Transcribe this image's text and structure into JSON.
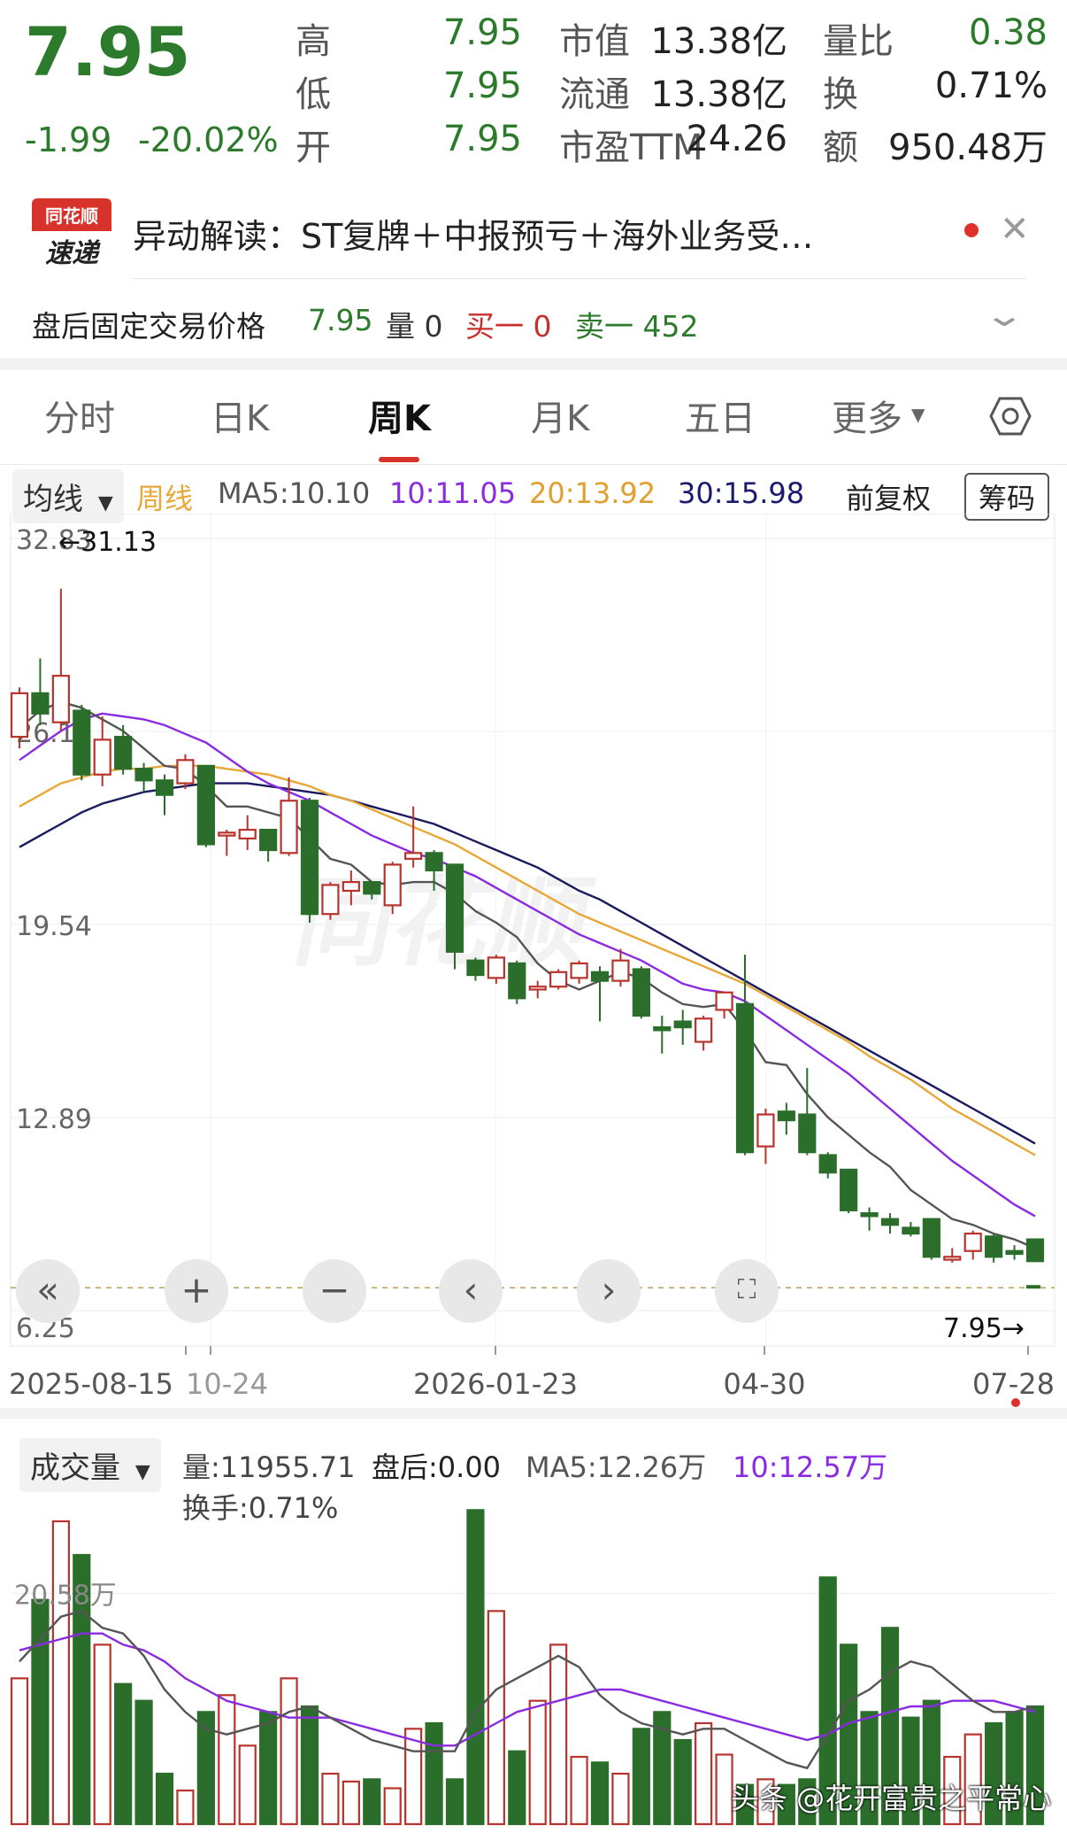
{
  "quote": {
    "price": "7.95",
    "change": "-1.99",
    "change_pct": "-20.02%",
    "rows": [
      {
        "l1": "高",
        "v1": "7.95",
        "l2": "市值",
        "v2": "13.38亿",
        "l3": "量比",
        "v3": "0.38"
      },
      {
        "l1": "低",
        "v1": "7.95",
        "l2": "流通",
        "v2": "13.38亿",
        "l3": "换",
        "v3": "0.71%"
      },
      {
        "l1": "开",
        "v1": "7.95",
        "l2": "市盈TTM",
        "v2": "24.26",
        "l3": "额",
        "v3": "950.48万"
      }
    ]
  },
  "news": {
    "badge_top": "同花顺",
    "badge_bottom": "速递",
    "text": "异动解读：ST复牌＋中报预亏＋海外业务受…"
  },
  "after_hours": {
    "label": "盘后固定交易价格",
    "price": "7.95",
    "volume": "量 0",
    "buy": "买一 0",
    "sell": "卖一 452"
  },
  "tabs": [
    "分时",
    "日K",
    "周K",
    "月K",
    "五日",
    "更多"
  ],
  "active_tab": "周K",
  "ma_bar": {
    "selector": "均线",
    "period": "周线",
    "ma5": "MA5:10.10",
    "ma10": "10:11.05",
    "ma20": "20:13.92",
    "ma30": "30:15.98",
    "adjust": "前复权",
    "chips": "筹码"
  },
  "volume_bar": {
    "selector": "成交量",
    "vol": "量:11955.71",
    "after": "盘后:0.00",
    "ma5": "MA5:12.26万",
    "ma10": "10:12.57万",
    "turnover": "换手:0.71%"
  },
  "watermark": "头条 @花开富贵之平常心",
  "colors": {
    "up": "#b8332c",
    "down": "#2b6e2b",
    "ma5": "#555555",
    "ma10": "#8a2be2",
    "ma20": "#e8a838",
    "ma30": "#1a1a5e"
  },
  "chart_data": {
    "type": "candlestick",
    "y_ticks": [
      "32.83",
      "26.19",
      "19.54",
      "12.89",
      "6.25"
    ],
    "x_labels": [
      "2025-08-15",
      "10-24",
      "2026-01-23",
      "04-30",
      "07-28"
    ],
    "max_label": "←31.13",
    "last_label": "7.95→",
    "ylim": [
      6.25,
      32.83
    ],
    "candles": [
      [
        26.0,
        27.5,
        25.6,
        27.7
      ],
      [
        27.5,
        26.8,
        26.4,
        28.7
      ],
      [
        26.5,
        28.1,
        26.2,
        31.1
      ],
      [
        26.9,
        24.7,
        24.5,
        27.1
      ],
      [
        24.7,
        25.9,
        24.3,
        26.7
      ],
      [
        26.0,
        24.9,
        24.7,
        26.4
      ],
      [
        24.9,
        24.5,
        24.1,
        25.1
      ],
      [
        24.5,
        24.0,
        23.3,
        24.7
      ],
      [
        24.4,
        25.2,
        24.2,
        25.4
      ],
      [
        25.0,
        22.3,
        22.2,
        25.0
      ],
      [
        22.6,
        22.7,
        21.9,
        22.8
      ],
      [
        22.5,
        22.8,
        22.1,
        23.3
      ],
      [
        22.8,
        22.1,
        21.7,
        22.8
      ],
      [
        22.0,
        23.8,
        21.9,
        24.6
      ],
      [
        23.8,
        19.9,
        19.6,
        23.9
      ],
      [
        19.9,
        20.9,
        19.7,
        21.0
      ],
      [
        20.7,
        21.0,
        20.2,
        21.4
      ],
      [
        21.0,
        20.6,
        20.4,
        21.0
      ],
      [
        20.2,
        21.6,
        19.9,
        21.7
      ],
      [
        21.8,
        22.0,
        21.5,
        23.6
      ],
      [
        22.0,
        21.4,
        20.7,
        22.1
      ],
      [
        21.6,
        18.6,
        18.0,
        21.6
      ],
      [
        18.3,
        17.8,
        17.6,
        18.4
      ],
      [
        17.7,
        18.4,
        17.5,
        18.5
      ],
      [
        18.2,
        17.0,
        16.8,
        18.3
      ],
      [
        17.3,
        17.4,
        17.0,
        17.6
      ],
      [
        17.4,
        17.9,
        17.3,
        18.0
      ],
      [
        17.7,
        18.2,
        17.5,
        18.3
      ],
      [
        17.9,
        17.6,
        16.2,
        18.1
      ],
      [
        17.6,
        18.3,
        17.4,
        18.7
      ],
      [
        18.0,
        16.4,
        16.3,
        18.1
      ],
      [
        16.0,
        15.9,
        15.1,
        16.4
      ],
      [
        16.2,
        16.0,
        15.4,
        16.6
      ],
      [
        15.5,
        16.3,
        15.2,
        16.4
      ],
      [
        16.6,
        17.2,
        16.3,
        17.2
      ],
      [
        16.8,
        11.7,
        11.6,
        18.5
      ],
      [
        11.9,
        13.0,
        11.3,
        13.2
      ],
      [
        13.1,
        12.8,
        12.3,
        13.4
      ],
      [
        13.0,
        11.7,
        11.6,
        14.6
      ],
      [
        11.6,
        11.0,
        10.8,
        11.7
      ],
      [
        11.1,
        9.7,
        9.6,
        11.1
      ],
      [
        9.6,
        9.5,
        9.0,
        9.8
      ],
      [
        9.4,
        9.2,
        8.9,
        9.6
      ],
      [
        9.1,
        8.9,
        8.8,
        9.3
      ],
      [
        9.4,
        8.1,
        8.0,
        9.4
      ],
      [
        8.0,
        8.1,
        7.9,
        8.4
      ],
      [
        8.3,
        8.9,
        8.0,
        9.0
      ],
      [
        8.8,
        8.1,
        7.9,
        8.9
      ],
      [
        8.3,
        8.2,
        8.0,
        8.5
      ],
      [
        8.7,
        7.95,
        7.95,
        8.7
      ]
    ],
    "ma5": [
      26.3,
      26.9,
      27.2,
      27.0,
      26.6,
      26.2,
      25.6,
      25.0,
      24.9,
      24.3,
      23.6,
      23.6,
      23.4,
      23.2,
      22.5,
      21.8,
      21.6,
      21.0,
      20.9,
      21.0,
      21.0,
      20.6,
      20.0,
      19.6,
      19.1,
      18.2,
      17.6,
      17.3,
      17.6,
      17.9,
      17.7,
      17.2,
      16.8,
      16.7,
      16.8,
      15.9,
      14.8,
      14.7,
      13.7,
      12.9,
      12.3,
      11.7,
      11.2,
      10.4,
      9.9,
      9.4,
      9.2,
      8.9,
      8.7,
      8.4
    ],
    "ma10": [
      25.2,
      25.7,
      26.2,
      26.6,
      26.8,
      26.7,
      26.6,
      26.4,
      26.1,
      25.8,
      25.3,
      24.8,
      24.4,
      24.1,
      23.8,
      23.4,
      23.0,
      22.6,
      22.3,
      22.0,
      21.8,
      21.5,
      21.2,
      20.8,
      20.4,
      20.0,
      19.6,
      19.2,
      18.9,
      18.6,
      18.3,
      17.9,
      17.5,
      17.3,
      17.2,
      16.9,
      16.4,
      15.9,
      15.4,
      14.9,
      14.4,
      13.8,
      13.2,
      12.6,
      12.0,
      11.4,
      10.9,
      10.4,
      9.9,
      9.5
    ],
    "ma20": [
      23.6,
      24.0,
      24.4,
      24.6,
      24.8,
      24.9,
      24.9,
      25.0,
      25.0,
      25.0,
      24.9,
      24.8,
      24.7,
      24.5,
      24.3,
      24.0,
      23.8,
      23.5,
      23.2,
      22.9,
      22.6,
      22.3,
      21.9,
      21.5,
      21.1,
      20.7,
      20.3,
      19.9,
      19.6,
      19.3,
      19.0,
      18.7,
      18.4,
      18.1,
      17.8,
      17.5,
      17.1,
      16.7,
      16.3,
      15.9,
      15.5,
      15.0,
      14.6,
      14.2,
      13.7,
      13.2,
      12.8,
      12.4,
      12.0,
      11.6
    ],
    "ma30": [
      22.2,
      22.6,
      23.0,
      23.4,
      23.7,
      23.9,
      24.1,
      24.2,
      24.3,
      24.4,
      24.4,
      24.4,
      24.3,
      24.2,
      24.1,
      24.0,
      23.8,
      23.6,
      23.4,
      23.2,
      23.0,
      22.7,
      22.4,
      22.1,
      21.8,
      21.5,
      21.1,
      20.7,
      20.4,
      20.0,
      19.6,
      19.2,
      18.8,
      18.4,
      18.0,
      17.6,
      17.2,
      16.8,
      16.4,
      16.0,
      15.6,
      15.2,
      14.8,
      14.4,
      14.0,
      13.6,
      13.2,
      12.8,
      12.4,
      12.0
    ],
    "volume_label": "20.58万",
    "volumes": [
      13,
      20,
      27,
      24,
      16,
      12.5,
      11,
      4.5,
      3,
      10,
      11.5,
      7,
      10,
      13,
      10.5,
      4.5,
      3.8,
      4,
      3.2,
      8.5,
      9,
      4,
      28,
      19,
      6.5,
      11,
      16,
      6,
      5.5,
      4.5,
      8.5,
      10,
      7.5,
      9,
      6.2,
      3.5,
      4,
      3.5,
      4,
      22,
      16,
      10,
      17.5,
      9.5,
      11,
      6,
      8,
      9,
      10,
      10.5
    ],
    "vol_ma5": [
      14.5,
      16.5,
      18.5,
      19,
      17.5,
      17,
      15,
      12,
      10,
      8.5,
      8,
      8.5,
      9,
      10,
      10.5,
      9.5,
      8.5,
      7.5,
      7,
      6.5,
      6.5,
      6.5,
      10,
      12,
      13,
      14,
      15,
      14,
      11.5,
      10,
      9,
      8.5,
      8,
      8.5,
      8.5,
      7.5,
      6.5,
      5.5,
      5,
      8,
      11,
      12,
      13.5,
      14.5,
      14,
      12.5,
      11,
      10,
      10,
      10.5
    ],
    "vol_ma10": [
      15.5,
      16,
      16.5,
      17,
      17,
      16,
      15.5,
      14.5,
      13,
      12,
      11,
      10.5,
      10,
      9.5,
      9.5,
      9.5,
      9,
      8.5,
      8,
      7.5,
      7,
      7,
      8,
      9,
      10,
      10.5,
      11,
      11.5,
      12,
      12,
      11.5,
      11,
      10.5,
      10,
      9.5,
      9,
      8.5,
      8,
      7.5,
      8,
      9,
      9.5,
      10,
      10.5,
      10.5,
      11,
      11,
      11,
      10.5,
      10
    ]
  }
}
